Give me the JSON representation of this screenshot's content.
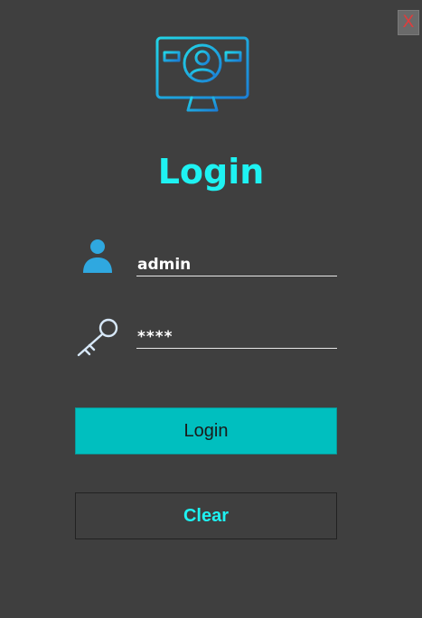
{
  "window": {
    "close_label": "X"
  },
  "header": {
    "logo_icon": "monitor-user-profile-icon",
    "title": "Login"
  },
  "form": {
    "username": {
      "icon": "user-icon",
      "value": "admin"
    },
    "password": {
      "icon": "key-icon",
      "value": "****"
    }
  },
  "actions": {
    "login_label": "Login",
    "clear_label": "Clear"
  },
  "colors": {
    "background": "#3f3f3f",
    "accent_cyan": "#1ef2f2",
    "login_button": "#00bfbf",
    "close_x": "#e23b3b",
    "user_icon": "#2fa8e0"
  }
}
